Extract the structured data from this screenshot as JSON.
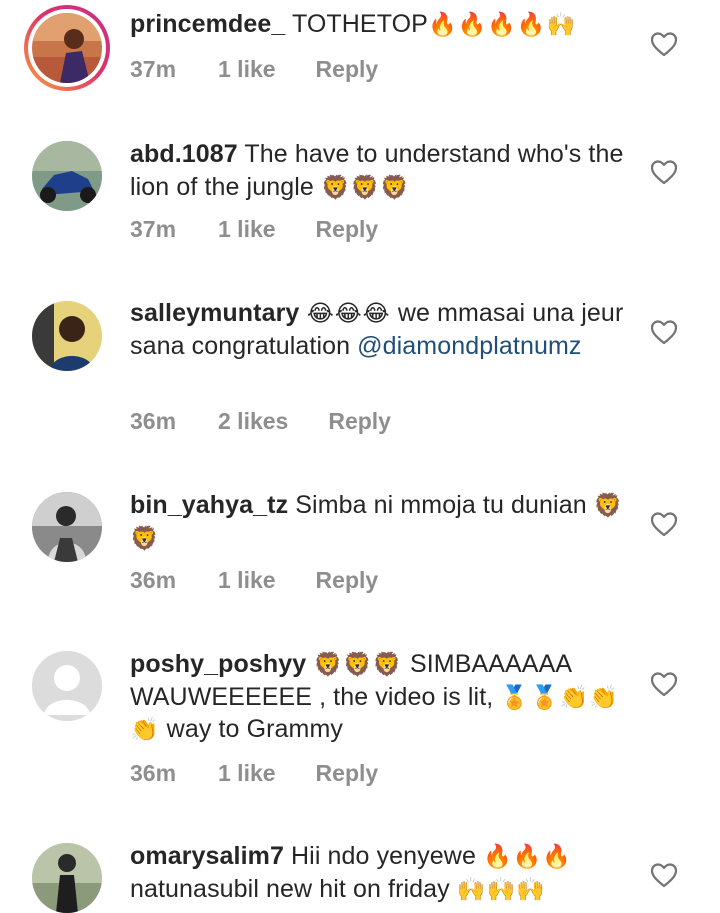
{
  "comments": [
    {
      "username": "princemdee_",
      "text": " TOTHETOP",
      "emoji_after": "🔥🔥🔥🔥🙌",
      "time": "37m",
      "likes": "1 like",
      "reply": "Reply"
    },
    {
      "username": "abd.1087",
      "text": " The have to understand who's the lion of the jungle ",
      "emoji_after": "🦁🦁🦁",
      "time": "37m",
      "likes": "1 like",
      "reply": "Reply"
    },
    {
      "username": "salleymuntary",
      "emoji_inline": " 😂😂😂 ",
      "text": "we mmasai una jeur sana congratulation ",
      "mention": "@diamondplatnumz",
      "time": "36m",
      "likes": "2 likes",
      "reply": "Reply"
    },
    {
      "username": "bin_yahya_tz",
      "text": " Simba ni mmoja tu dunian ",
      "emoji_after": "🦁🦁",
      "time": "36m",
      "likes": "1 like",
      "reply": "Reply"
    },
    {
      "username": "poshy_poshyy",
      "emoji_inline": " 🦁🦁🦁 ",
      "text": "SIMBAAAAAA WAUWEEEEEE , the video is lit, ",
      "emoji_mid": "🏅🏅👏👏👏",
      "text_end": " way to Grammy",
      "time": "36m",
      "likes": "1 like",
      "reply": "Reply"
    },
    {
      "username": "omarysalim7",
      "text": " Hii ndo yenyewe ",
      "emoji_mid": "🔥🔥🔥",
      "text_end": " natunasubil new hit on friday ",
      "emoji_after": "🙌🙌🙌"
    }
  ],
  "icons": {
    "heart": "heart-outline-icon",
    "colors": {
      "heart_stroke": "#737373",
      "meta_text": "#8e8e8e",
      "mention": "#1f4e7a"
    }
  }
}
